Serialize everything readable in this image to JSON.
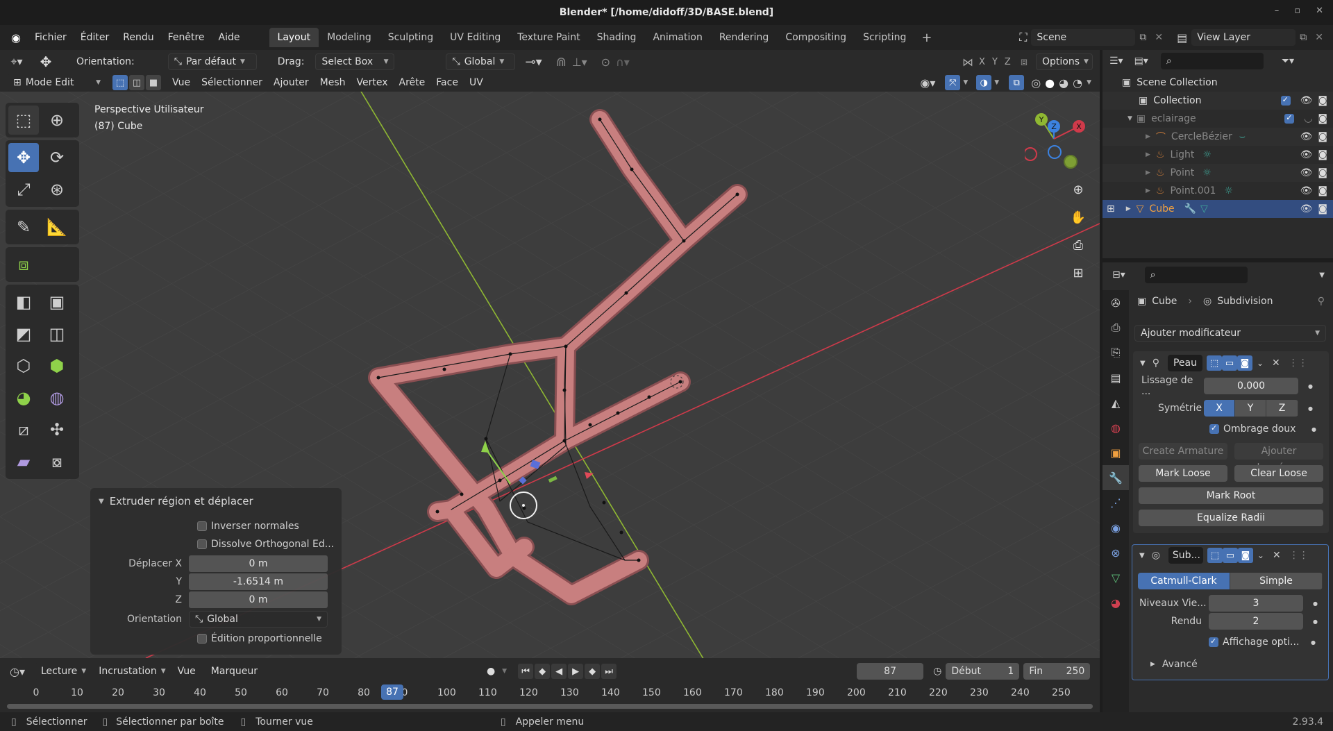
{
  "window": {
    "title": "Blender* [/home/didoff/3D/BASE.blend]",
    "min": "–",
    "max": "▫",
    "close": "✕"
  },
  "menus": [
    "Fichier",
    "Éditer",
    "Rendu",
    "Fenêtre",
    "Aide"
  ],
  "workspaces": [
    "Layout",
    "Modeling",
    "Sculpting",
    "UV Editing",
    "Texture Paint",
    "Shading",
    "Animation",
    "Rendering",
    "Compositing",
    "Scripting"
  ],
  "scene": {
    "label": "Scene",
    "view_layer": "View Layer"
  },
  "tool_header": {
    "orientation_label": "Orientation:",
    "orientation_value": "Par défaut",
    "drag_label": "Drag:",
    "drag_value": "Select Box",
    "transform_value": "Global",
    "axis_x": "X",
    "axis_y": "Y",
    "axis_z": "Z",
    "options": "Options"
  },
  "vp_header": {
    "mode": "Mode Edit",
    "menu": [
      "Vue",
      "Sélectionner",
      "Ajouter",
      "Mesh",
      "Vertex",
      "Arête",
      "Face",
      "UV"
    ]
  },
  "viewport": {
    "perspective": "Perspective Utilisateur",
    "object": "(87) Cube"
  },
  "gizmo": {
    "x": "X",
    "y": "Y",
    "z": "Z"
  },
  "operator": {
    "title": "Extruder région et déplacer",
    "flip_normals": "Inverser normales",
    "dissolve": "Dissolve Orthogonal Ed...",
    "move_x_label": "Déplacer X",
    "move_x": "0 m",
    "move_y_label": "Y",
    "move_y": "-1.6514 m",
    "move_z_label": "Z",
    "move_z": "0 m",
    "orientation_label": "Orientation",
    "orientation": "Global",
    "proportional": "Édition proportionnelle"
  },
  "timeline": {
    "menus": [
      "Lecture",
      "Incrustation",
      "Vue",
      "Marqueur"
    ],
    "current_frame": "87",
    "start_label": "Début",
    "start": "1",
    "end_label": "Fin",
    "end": "250",
    "ticks": [
      "0",
      "10",
      "20",
      "30",
      "40",
      "50",
      "60",
      "70",
      "80",
      "0",
      "100",
      "110",
      "120",
      "130",
      "140",
      "150",
      "160",
      "170",
      "180",
      "190",
      "200",
      "210",
      "220",
      "230",
      "240",
      "250"
    ]
  },
  "status": {
    "select": "Sélectionner",
    "box": "Sélectionner par boîte",
    "rotate": "Tourner vue",
    "menu": "Appeler menu",
    "version": "2.93.4"
  },
  "outliner": {
    "items": [
      {
        "name": "Scene Collection",
        "level": 0
      },
      {
        "name": "Collection",
        "level": 1
      },
      {
        "name": "eclairage",
        "level": 1
      },
      {
        "name": "CercleBézier",
        "level": 2
      },
      {
        "name": "Light",
        "level": 2
      },
      {
        "name": "Point",
        "level": 2
      },
      {
        "name": "Point.001",
        "level": 2
      },
      {
        "name": "Cube",
        "level": 1
      }
    ]
  },
  "properties": {
    "breadcrumb_object": "Cube",
    "breadcrumb_modifier": "Subdivision",
    "add_modifier": "Ajouter modificateur",
    "skin": {
      "name": "Peau",
      "smooth_label": "Lissage de ...",
      "smooth_value": "0.000",
      "symmetry_label": "Symétrie",
      "sym_x": "X",
      "sym_y": "Y",
      "sym_z": "Z",
      "smooth_shading": "Ombrage doux",
      "create_armature": "Create Armature",
      "add_data": "Ajouter données...",
      "mark_loose": "Mark Loose",
      "clear_loose": "Clear Loose",
      "mark_root": "Mark Root",
      "equalize": "Equalize Radii"
    },
    "subsurf": {
      "name": "Sub...",
      "catmull": "Catmull-Clark",
      "simple": "Simple",
      "levels_label": "Niveaux Vie...",
      "levels_value": "3",
      "render_label": "Rendu",
      "render_value": "2",
      "optimal": "Affichage opti...",
      "advanced": "Avancé"
    }
  },
  "colors": {
    "accent": "#4772b3",
    "mesh": "#c87f7f",
    "x_axis": "#d03a4a",
    "y_axis": "#8fb832",
    "selected_row": "#334d80"
  }
}
